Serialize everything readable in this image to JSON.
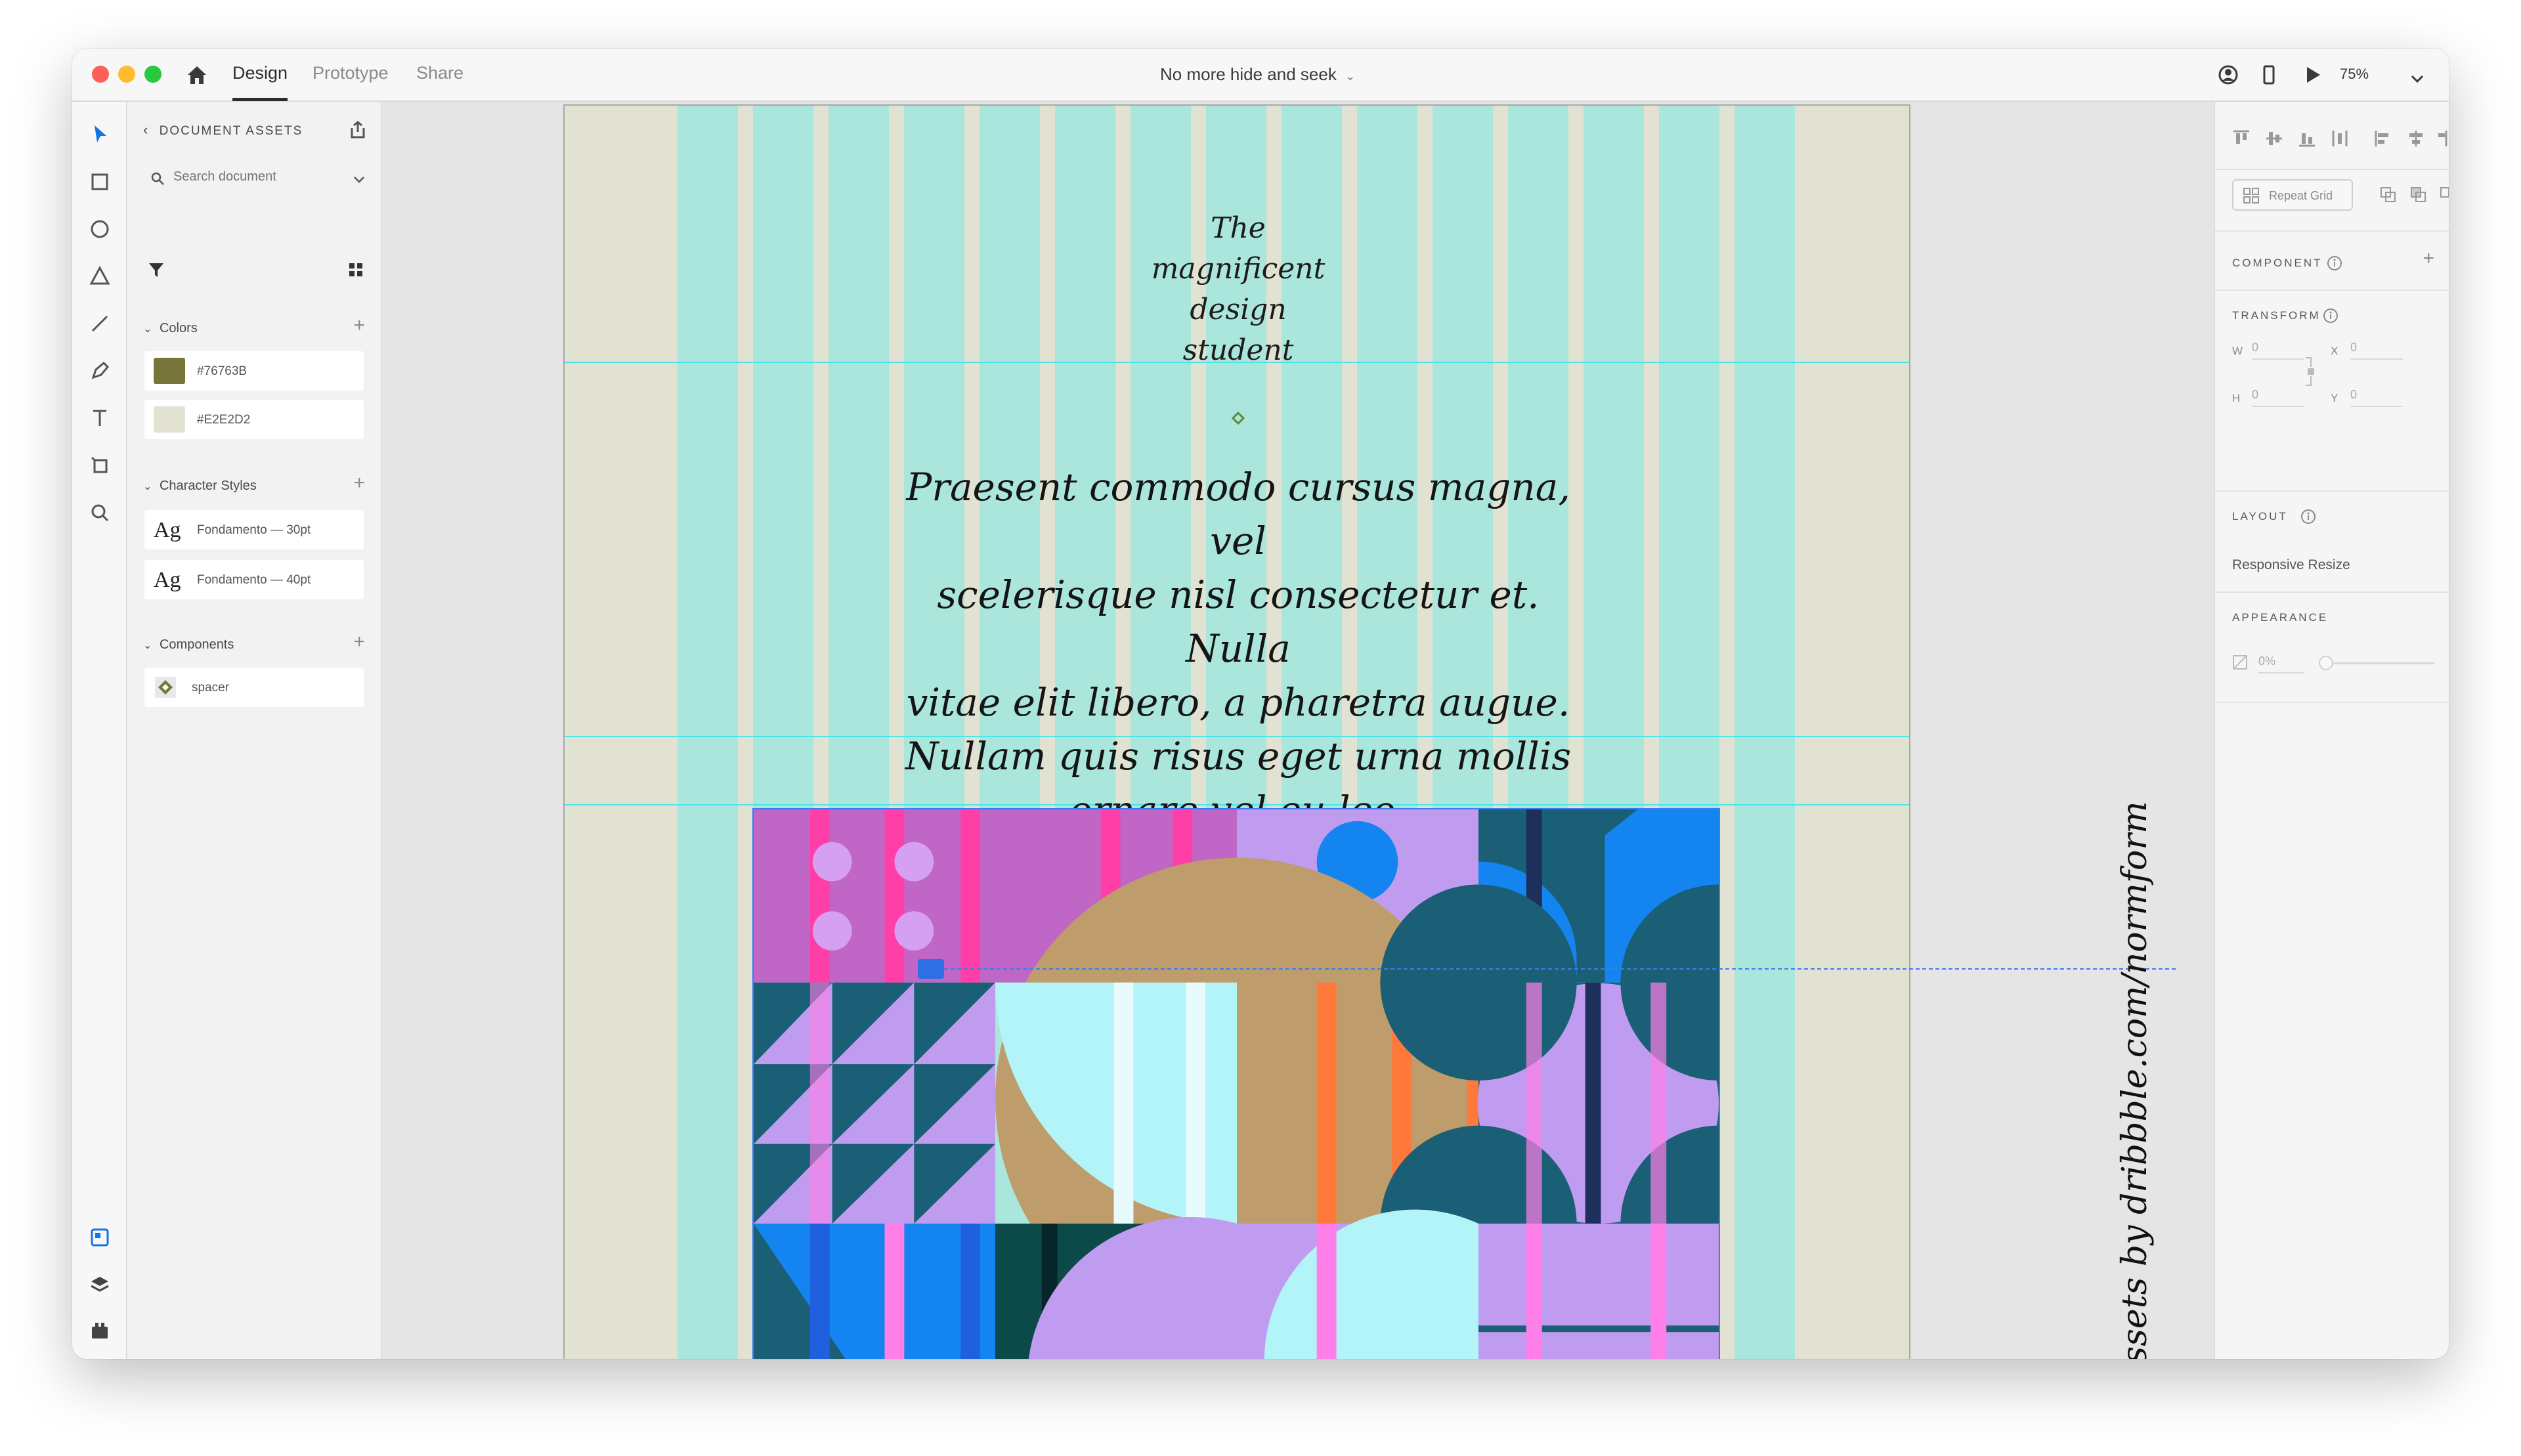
{
  "window": {
    "tabs": [
      {
        "label": "Design",
        "active": true
      },
      {
        "label": "Prototype",
        "active": false
      },
      {
        "label": "Share",
        "active": false
      }
    ],
    "doc_title": "No more hide and seek",
    "zoom": "75%"
  },
  "assets": {
    "header": "DOCUMENT ASSETS",
    "search_placeholder": "Search document",
    "colors_title": "Colors",
    "colors": [
      {
        "label": "#76763B",
        "hex": "#76763b"
      },
      {
        "label": "#E2E2D2",
        "hex": "#e2e2d2"
      }
    ],
    "char_styles_title": "Character Styles",
    "char_styles": [
      {
        "glyph": "Ag",
        "label": "Fondamento — 30pt"
      },
      {
        "glyph": "Ag",
        "label": "Fondamento — 40pt"
      }
    ],
    "components_title": "Components",
    "components": [
      {
        "label": "spacer"
      }
    ]
  },
  "artboard": {
    "title_lines": [
      "The",
      "magnificent",
      "design",
      "student"
    ],
    "body_lines": [
      "Praesent commodo cursus magna, vel",
      "scelerisque nisl consectetur et. Nulla",
      "vitae elit libero, a pharetra augue.",
      "Nullam quis risus eget urna mollis",
      "ornare vel eu leo."
    ],
    "credit": "Assets by dribbble.com/normform"
  },
  "properties": {
    "repeat_grid": "Repeat Grid",
    "component_label": "COMPONENT",
    "transform_label": "TRANSFORM",
    "w_label": "W",
    "w_value": "0",
    "x_label": "X",
    "x_value": "0",
    "h_label": "H",
    "h_value": "0",
    "y_label": "Y",
    "y_value": "0",
    "layout_label": "LAYOUT",
    "responsive_resize": "Responsive Resize",
    "appearance_label": "APPEARANCE",
    "opacity": "0%"
  },
  "colors": {
    "grid_column": "#abe6dc",
    "artboard_bg": "#e2e2d2",
    "guide": "#4ee3e6",
    "selection": "#3b7cf0"
  }
}
